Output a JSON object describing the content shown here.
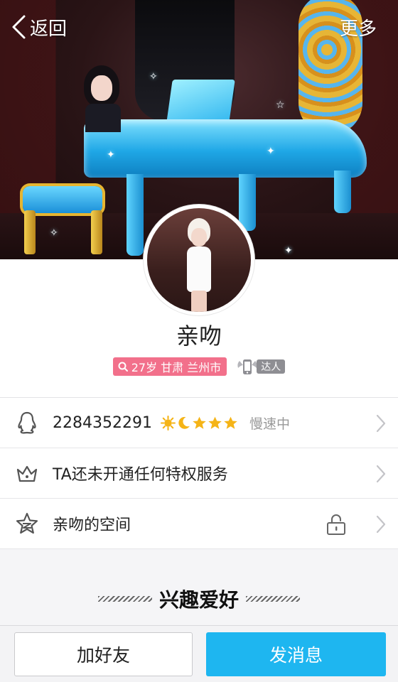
{
  "nav": {
    "back_label": "返回",
    "more_label": "更多"
  },
  "profile": {
    "nickname": "亲吻",
    "info_tag": "27岁 甘肃 兰州市",
    "expert_badge": "达人"
  },
  "rows": [
    {
      "text": "2284352291",
      "status": "慢速中",
      "level_icons": [
        "sun-icon",
        "moon-icon",
        "star-icon",
        "star-icon",
        "star-icon"
      ]
    },
    {
      "text": "TA还未开通任何特权服务"
    },
    {
      "text": "亲吻的空间"
    }
  ],
  "interests": {
    "title": "兴趣爱好"
  },
  "actions": {
    "add_friend": "加好友",
    "send_message": "发消息"
  },
  "colors": {
    "accent": "#1eb6f0",
    "info_tag": "#f2708b",
    "level_gold": "#f5b417",
    "muted_text": "#999999"
  }
}
